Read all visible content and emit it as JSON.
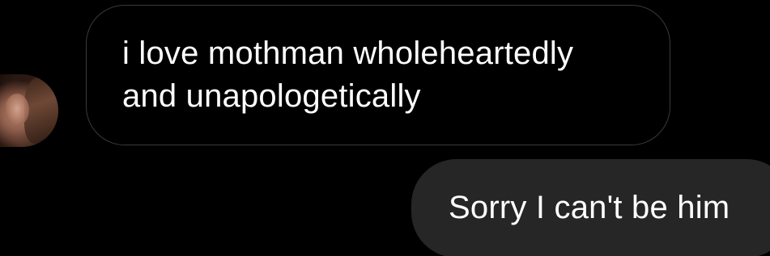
{
  "messages": {
    "received": {
      "text": "i love mothman wholeheartedly\nand unapologetically"
    },
    "sent": {
      "text": "Sorry I can't be him"
    }
  },
  "colors": {
    "background": "#000000",
    "received_bubble_border": "#3a3a3a",
    "sent_bubble_fill": "#262626",
    "text": "#ffffff"
  },
  "icons": {
    "avatar": "sender-avatar-photo"
  }
}
